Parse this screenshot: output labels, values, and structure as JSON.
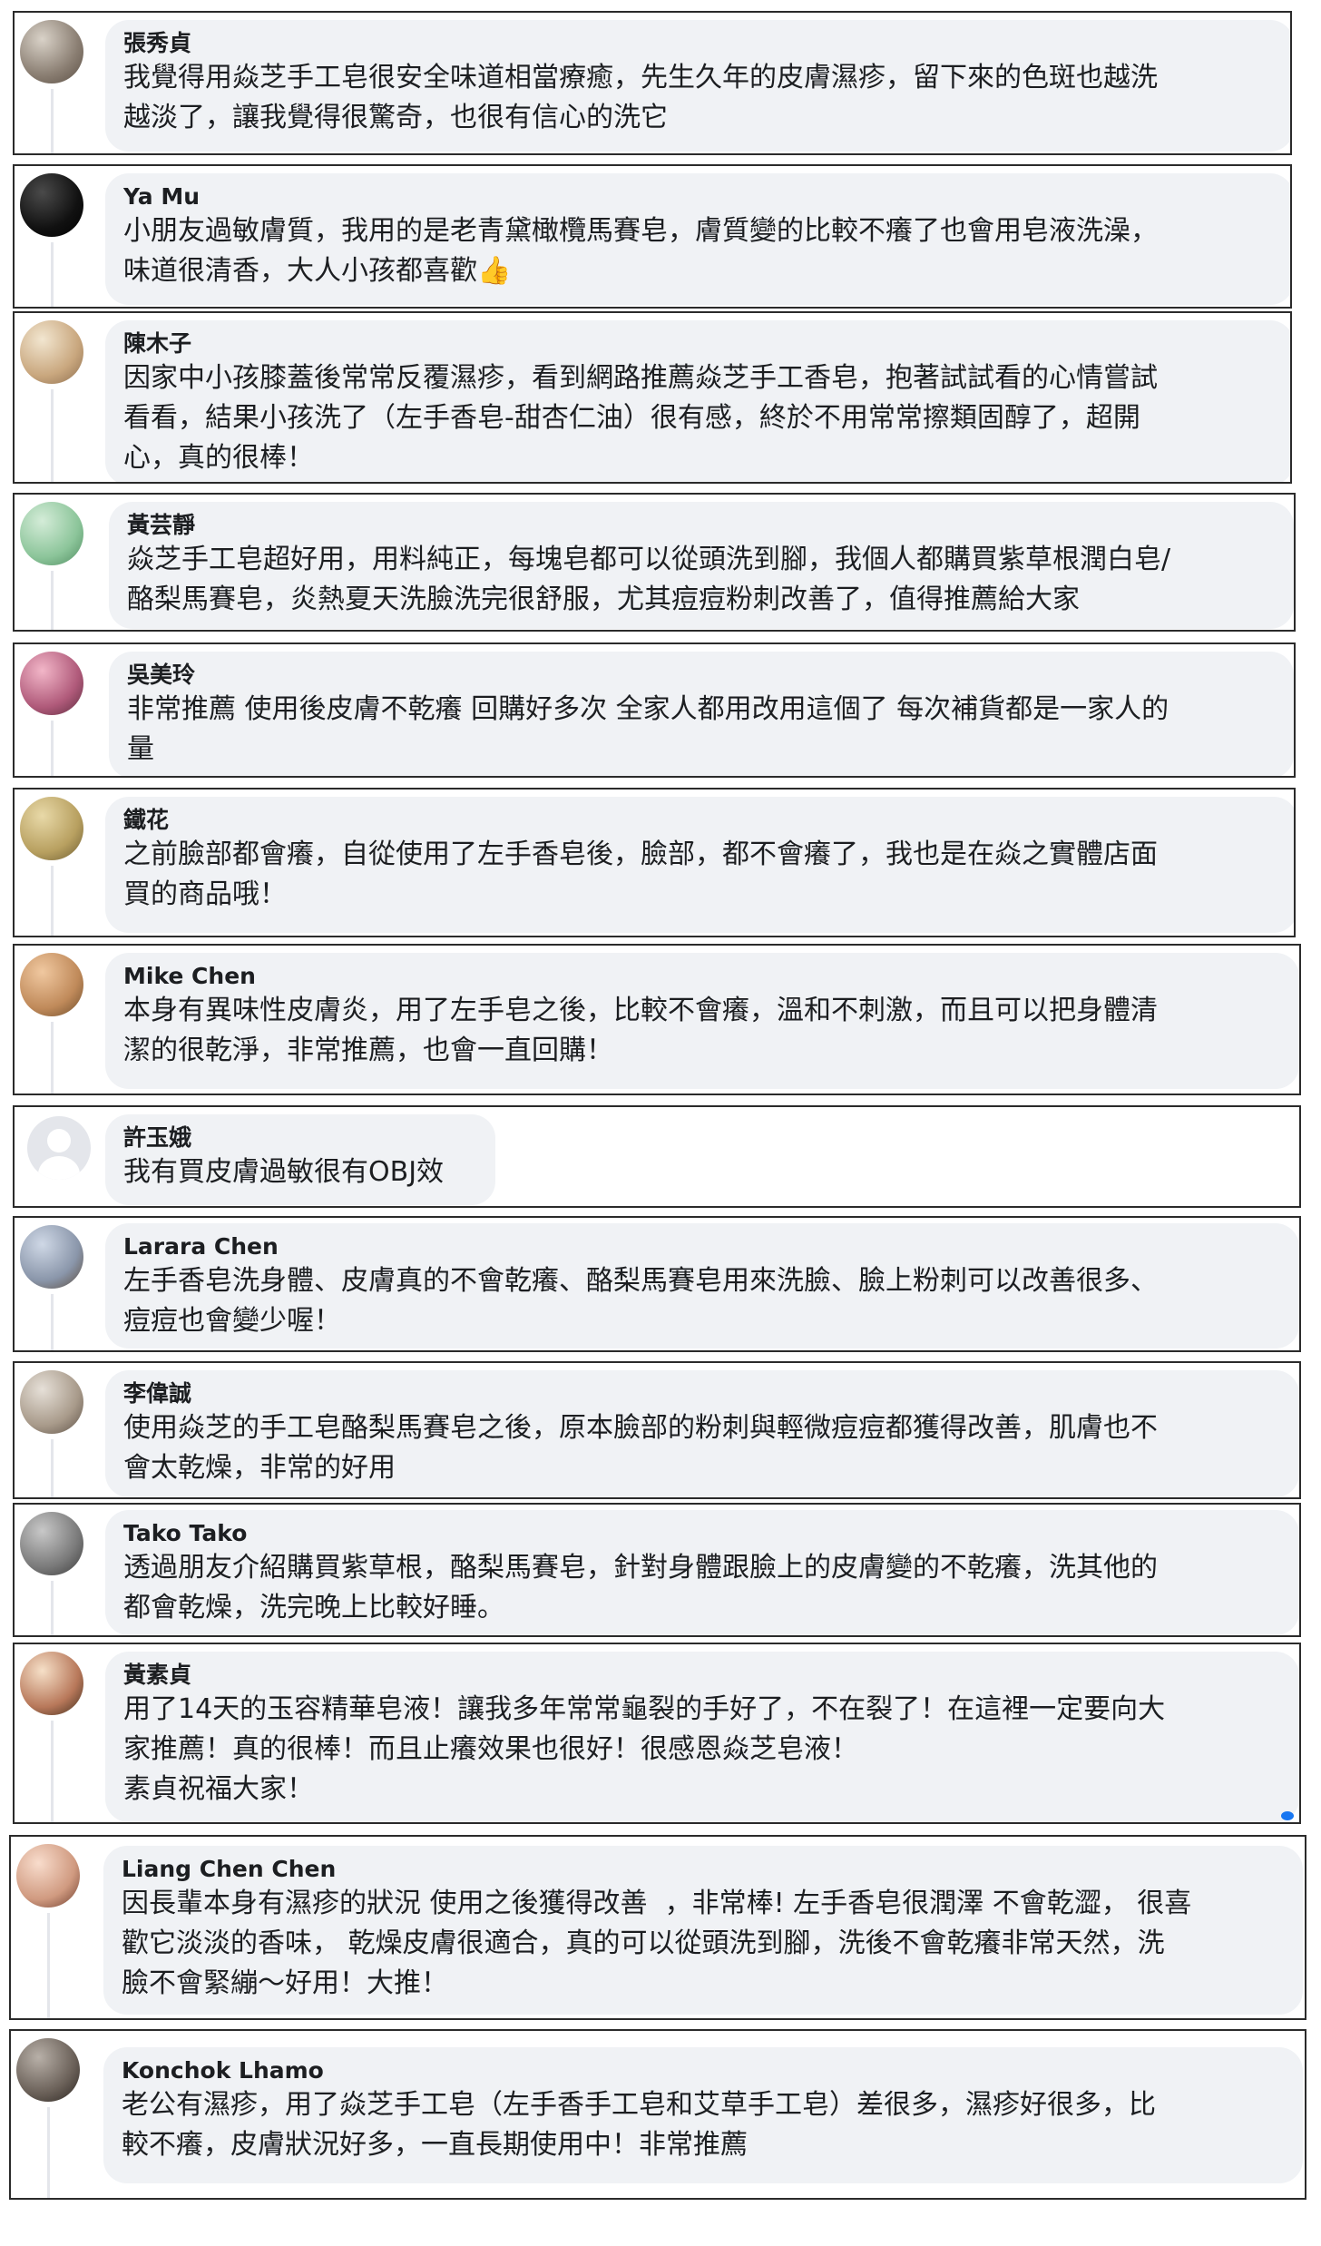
{
  "comments": [
    {
      "author": "張秀貞",
      "text": "我覺得用焱芝手工皂很安全味道相當療癒，先生久年的皮膚濕疹，留下來的色斑也越洗\n越淡了，讓我覺得很驚奇，也很有信心的洗它",
      "avatar": "photo-avatar",
      "colors": [
        "#d9d2c8",
        "#8a7e72",
        "#5a4e44"
      ]
    },
    {
      "author": "Ya Mu",
      "text": "小朋友過敏膚質，我用的是老青黛橄欖馬賽皂，膚質變的比較不癢了也會用皂液洗澡，\n味道很清香，大人小孩都喜歡👍",
      "avatar": "photo-avatar",
      "colors": [
        "#4a4a4a",
        "#111111",
        "#000000"
      ]
    },
    {
      "author": "陳木子",
      "text": "因家中小孩膝蓋後常常反覆濕疹，看到網路推薦焱芝手工香皂，抱著試試看的心情嘗試\n看看，結果小孩洗了（左手香皂-甜杏仁油）很有感，終於不用常常擦類固醇了，超開\n心，真的很棒！",
      "avatar": "photo-avatar",
      "colors": [
        "#f2e6d0",
        "#c9a77e",
        "#8a6b4c"
      ]
    },
    {
      "author": "黃芸靜",
      "text": "焱芝手工皂超好用，用料純正，每塊皂都可以從頭洗到腳，我個人都購買紫草根潤白皂/\n酪梨馬賽皂，炎熱夏天洗臉洗完很舒服，尤其痘痘粉刺改善了，值得推薦給大家",
      "avatar": "photo-avatar",
      "colors": [
        "#d4ecd8",
        "#8cc59a",
        "#4d8a5e"
      ]
    },
    {
      "author": "吳美玲",
      "text": "非常推薦 使用後皮膚不乾癢 回購好多次 全家人都用改用這個了 每次補貨都是一家人的\n量",
      "avatar": "photo-avatar",
      "colors": [
        "#f2b6c8",
        "#b05a7a",
        "#5a2a3c"
      ]
    },
    {
      "author": "鐵花",
      "text": "之前臉部都會癢，自從使用了左手香皂後，臉部，都不會癢了，我也是在焱之實體店面\n買的商品哦！",
      "avatar": "photo-avatar",
      "colors": [
        "#e8d9a8",
        "#b8a060",
        "#6a5a30"
      ]
    },
    {
      "author": "Mike Chen",
      "text": "本身有異味性皮膚炎，用了左手皂之後，比較不會癢，溫和不刺激，而且可以把身體清\n潔的很乾淨，非常推薦，也會一直回購！",
      "avatar": "photo-avatar",
      "colors": [
        "#f0c8a0",
        "#c08a5a",
        "#6a4a2a"
      ]
    },
    {
      "author": "許玉娥",
      "text": "我有買皮膚過敏很有OBJ效",
      "avatar": "default-avatar",
      "colors": [
        "#e4e6eb",
        "#e4e6eb",
        "#e4e6eb"
      ]
    },
    {
      "author": "Larara Chen",
      "text": "左手香皂洗身體、皮膚真的不會乾癢、酪梨馬賽皂用來洗臉、臉上粉刺可以改善很多、\n痘痘也會變少喔！",
      "avatar": "photo-avatar",
      "colors": [
        "#cfd8e6",
        "#8a96aa",
        "#5a4a3a"
      ]
    },
    {
      "author": "李偉誠",
      "text": "使用焱芝的手工皂酪梨馬賽皂之後，原本臉部的粉刺與輕微痘痘都獲得改善，肌膚也不\n會太乾燥，非常的好用",
      "avatar": "photo-avatar",
      "colors": [
        "#e6e0d8",
        "#a89a8a",
        "#5a4e44"
      ]
    },
    {
      "author": "Tako Tako",
      "text": "透過朋友介紹購買紫草根，酪梨馬賽皂，針對身體跟臉上的皮膚變的不乾癢，洗其他的\n都會乾燥，洗完晚上比較好睡。",
      "avatar": "photo-avatar",
      "colors": [
        "#c8c8c8",
        "#7a7a7a",
        "#3a3a3a"
      ]
    },
    {
      "author": "黃素貞",
      "text": "用了14天的玉容精華皂液！讓我多年常常龜裂的手好了，不在裂了！在這裡一定要向大\n家推薦！真的很棒！而且止癢效果也很好！很感恩焱芝皂液！\n素貞祝福大家！",
      "avatar": "photo-avatar",
      "colors": [
        "#f6e0c8",
        "#b8785a",
        "#3a2a1a"
      ]
    },
    {
      "author": "Liang Chen Chen",
      "text": "因長輩本身有濕疹的狀況 使用之後獲得改善  ，非常棒! 左手香皂很潤澤 不會乾澀， 很喜\n歡它淡淡的香味， 乾燥皮膚很適合，真的可以從頭洗到腳，洗後不會乾癢非常天然，洗\n臉不會緊繃～好用！大推！",
      "avatar": "photo-avatar",
      "colors": [
        "#f8dccc",
        "#d09a80",
        "#6a3a2a"
      ]
    },
    {
      "author": "Konchok Lhamo",
      "text": "老公有濕疹，用了焱芝手工皂（左手香手工皂和艾草手工皂）差很多，濕疹好很多，比\n較不癢，皮膚狀況好多，一直長期使用中！非常推薦",
      "avatar": "photo-avatar",
      "colors": [
        "#b8b0a8",
        "#6a6058",
        "#2a2420"
      ]
    }
  ]
}
